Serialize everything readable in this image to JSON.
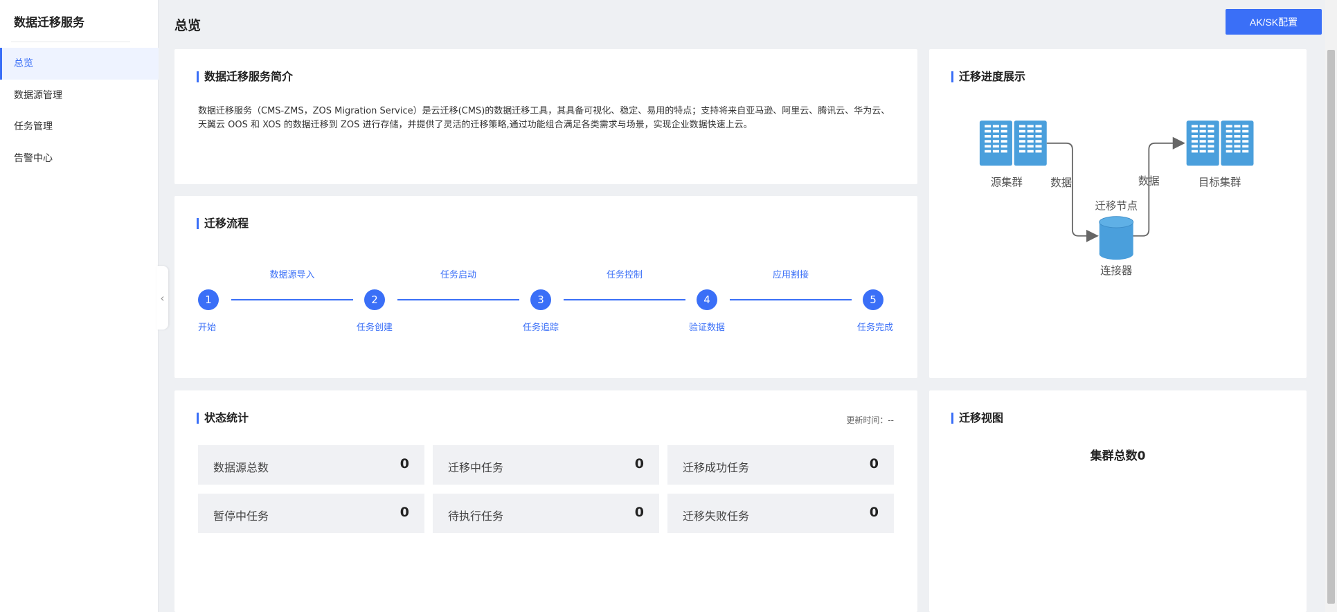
{
  "sidebar": {
    "title": "数据迁移服务",
    "items": [
      {
        "label": "总览",
        "active": true
      },
      {
        "label": "数据源管理"
      },
      {
        "label": "任务管理"
      },
      {
        "label": "告警中心"
      }
    ],
    "collapse_icon": "‹"
  },
  "header": {
    "title": "总览",
    "ak_button": "AK/SK配置"
  },
  "intro": {
    "title": "数据迁移服务简介",
    "text": "数据迁移服务（CMS-ZMS，ZOS Migration Service）是云迁移(CMS)的数据迁移工具，其具备可视化、稳定、易用的特点；支持将来自亚马逊、阿里云、腾讯云、华为云、天翼云 OOS 和 XOS 的数据迁移到 ZOS 进行存储，并提供了灵活的迁移策略,通过功能组合满足各类需求与场景，实现企业数据快速上云。"
  },
  "process": {
    "title": "迁移流程",
    "steps": [
      {
        "num": "1",
        "label": "开始"
      },
      {
        "num": "2",
        "label": "任务创建"
      },
      {
        "num": "3",
        "label": "任务追踪"
      },
      {
        "num": "4",
        "label": "验证数据"
      },
      {
        "num": "5",
        "label": "任务完成"
      }
    ],
    "connectors": [
      "数据源导入",
      "任务启动",
      "任务控制",
      "应用割接"
    ]
  },
  "progress": {
    "title": "迁移进度展示",
    "source": "源集群",
    "target": "目标集群",
    "node": "迁移节点",
    "connector": "连接器",
    "data_left": "数据",
    "data_right": "数据"
  },
  "stats": {
    "title": "状态统计",
    "update_time": "更新时间：--",
    "items": [
      {
        "label": "数据源总数",
        "value": "0"
      },
      {
        "label": "迁移中任务",
        "value": "0"
      },
      {
        "label": "迁移成功任务",
        "value": "0"
      },
      {
        "label": "暂停中任务",
        "value": "0"
      },
      {
        "label": "待执行任务",
        "value": "0"
      },
      {
        "label": "迁移失败任务",
        "value": "0"
      }
    ]
  },
  "view": {
    "title": "迁移视图",
    "cluster_total": "集群总数0"
  },
  "colors": {
    "accent": "#3a6ff7",
    "server": "#4a9fdc",
    "background": "#eef0f3"
  }
}
